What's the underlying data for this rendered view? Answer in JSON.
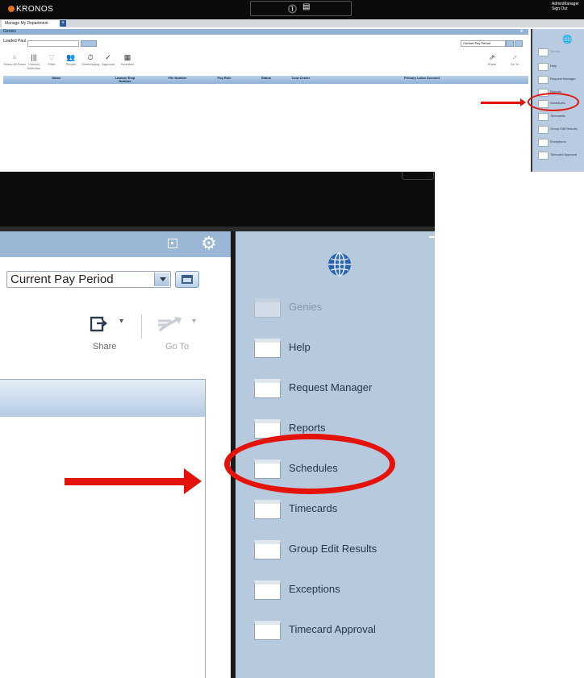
{
  "top": {
    "brand": "KRONOS",
    "user_lines": [
      "AdminManager",
      "Sign Out"
    ],
    "tab_label": "Manage My Department",
    "tab_add": "+",
    "bar_title": "Genies",
    "search_label": "Loaded Paul",
    "search_button": "Q",
    "pay_period": "Current Pay Period",
    "tools": [
      {
        "label": "Select All Rows",
        "glyph": "≡",
        "dim": true
      },
      {
        "label": "Column Selection",
        "glyph": "|||",
        "dim": false
      },
      {
        "label": "Filter",
        "glyph": "▽",
        "dim": true
      },
      {
        "label": "People",
        "glyph": "👥",
        "dim": false
      },
      {
        "label": "Timekeeping",
        "glyph": "⏱",
        "dim": false
      },
      {
        "label": "Approval",
        "glyph": "✓",
        "dim": false
      },
      {
        "label": "Schedule",
        "glyph": "▦",
        "dim": false
      }
    ],
    "right_tools": [
      {
        "label": "Share"
      },
      {
        "label": "Go To"
      }
    ],
    "columns": [
      "Name",
      "Lawson Emp Number",
      "File Number",
      "Pay Rule",
      "Status",
      "Cost Center",
      "Primary Labor Account"
    ],
    "panel_items": [
      "Genies",
      "Help",
      "Request Manager",
      "Reports",
      "Schedules",
      "Timecards",
      "Group Edit Results",
      "Exceptions",
      "Timecard Approval"
    ]
  },
  "zoom": {
    "pay_period": "Current Pay Period",
    "share_label": "Share",
    "goto_label": "Go To",
    "panel_items": [
      {
        "label": "Genies",
        "dim": true
      },
      {
        "label": "Help",
        "dim": false
      },
      {
        "label": "Request Manager",
        "dim": false
      },
      {
        "label": "Reports",
        "dim": false
      },
      {
        "label": "Schedules",
        "dim": false
      },
      {
        "label": "Timecards",
        "dim": false
      },
      {
        "label": "Group Edit Results",
        "dim": false
      },
      {
        "label": "Exceptions",
        "dim": false
      },
      {
        "label": "Timecard Approval",
        "dim": false
      }
    ]
  },
  "colors": {
    "highlight": "#e3120b",
    "panel_bg": "#b7c9dc",
    "header_blue": "#9ab7d6"
  }
}
